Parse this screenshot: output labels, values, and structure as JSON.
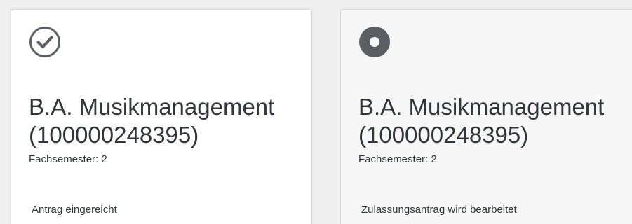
{
  "cards": [
    {
      "status": "submitted",
      "icon": "check-circle-icon",
      "title_line1": "B.A. Musikmanagement",
      "title_line2": "(100000248395)",
      "subtitle": "Fachsemester: 2",
      "footer": "Antrag eingereicht"
    },
    {
      "status": "in-progress",
      "icon": "in-progress-circle-icon",
      "title_line1": "B.A. Musikmanagement",
      "title_line2": "(100000248395)",
      "subtitle": "Fachsemester: 2",
      "footer": "Zulassungsantrag wird bearbeitet"
    }
  ],
  "colors": {
    "text": "#32363a",
    "icon": "#5b5f63",
    "card_bg_active": "#ffffff",
    "card_bg_inactive": "#f7f7f7",
    "border": "#d8d8d8"
  }
}
